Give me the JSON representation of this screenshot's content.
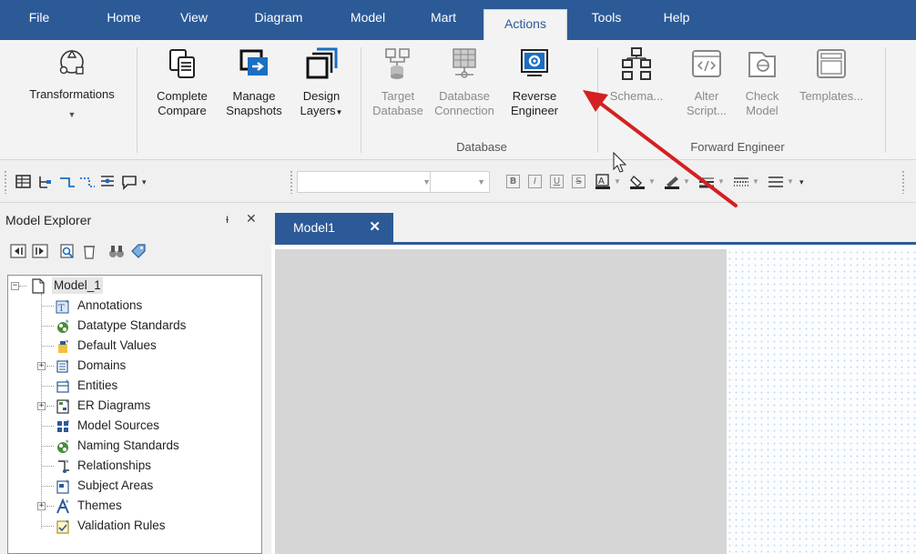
{
  "menu": {
    "tabs": [
      "File",
      "Home",
      "View",
      "Diagram",
      "Model",
      "Mart",
      "Actions",
      "Tools",
      "Help"
    ],
    "active_tab": "Actions"
  },
  "ribbon": {
    "transformations": "Transformations",
    "complete_compare": [
      "Complete",
      "Compare"
    ],
    "manage_snapshots": [
      "Manage",
      "Snapshots"
    ],
    "design_layers": [
      "Design",
      "Layers"
    ],
    "target_database": [
      "Target",
      "Database"
    ],
    "database_connection": [
      "Database",
      "Connection"
    ],
    "reverse_engineer": [
      "Reverse",
      "Engineer"
    ],
    "database_group": "Database",
    "schema": "Schema...",
    "alter_script": [
      "Alter",
      "Script..."
    ],
    "check_model": [
      "Check",
      "Model"
    ],
    "templates": "Templates...",
    "forward_engineer_group": "Forward Engineer"
  },
  "toolbar": {
    "format_buttons": [
      "B",
      "I",
      "U",
      "S"
    ]
  },
  "explorer": {
    "title": "Model Explorer",
    "pin_glyph": "ᵻ",
    "close_glyph": "✕",
    "root": "Model_1",
    "items": [
      {
        "label": "Annotations",
        "expandable": false
      },
      {
        "label": "Datatype Standards",
        "expandable": false
      },
      {
        "label": "Default Values",
        "expandable": false
      },
      {
        "label": "Domains",
        "expandable": true
      },
      {
        "label": "Entities",
        "expandable": false
      },
      {
        "label": "ER Diagrams",
        "expandable": true
      },
      {
        "label": "Model Sources",
        "expandable": false
      },
      {
        "label": "Naming Standards",
        "expandable": false
      },
      {
        "label": "Relationships",
        "expandable": false
      },
      {
        "label": "Subject Areas",
        "expandable": false
      },
      {
        "label": "Themes",
        "expandable": true
      },
      {
        "label": "Validation Rules",
        "expandable": false
      }
    ]
  },
  "document": {
    "tab_label": "Model1",
    "tab_close": "✕"
  },
  "colors": {
    "menubar": "#2c5a97",
    "accent_blue": "#1b6ec2",
    "arrow_red": "#d42020"
  }
}
